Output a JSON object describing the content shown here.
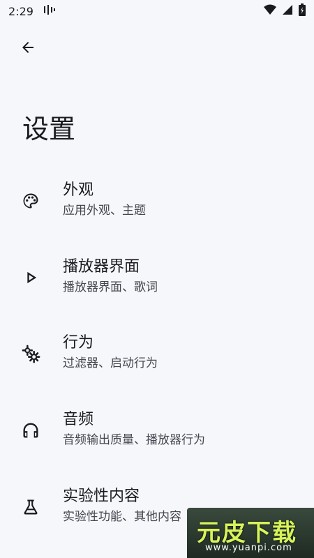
{
  "status_bar": {
    "time": "2:29",
    "icons": [
      "media-indicator-icon",
      "wifi-icon",
      "cell-signal-icon",
      "battery-icon"
    ]
  },
  "header": {
    "back_icon": "arrow-back-icon",
    "title": "设置"
  },
  "settings": [
    {
      "title": "外观",
      "subtitle": "应用外观、主题",
      "icon": "palette-icon"
    },
    {
      "title": "播放器界面",
      "subtitle": "播放器界面、歌词",
      "icon": "play-arrow-icon"
    },
    {
      "title": "行为",
      "subtitle": "过滤器、启动行为",
      "icon": "gears-icon"
    },
    {
      "title": "音频",
      "subtitle": "音频输出质量、播放器行为",
      "icon": "headphones-icon"
    },
    {
      "title": "实验性内容",
      "subtitle": "实验性功能、其他内容",
      "icon": "flask-icon"
    }
  ],
  "watermark": {
    "brand": "元皮下载",
    "url": "www.yuanpi.com"
  }
}
